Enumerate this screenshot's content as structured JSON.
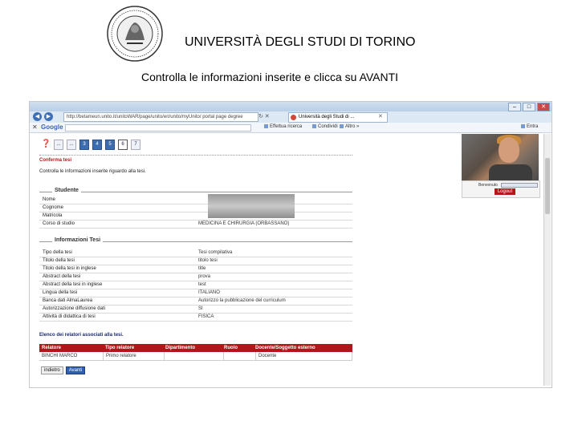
{
  "header": {
    "university": "UNIVERSITÀ DEGLI STUDI DI TORINO",
    "instruction": "Controlla le informazioni inserite e clicca su AVANTI"
  },
  "browser": {
    "address": "http://betameun.unito.it/unitoWAR/page/unito/en/unito/myUnito/ portal page degree",
    "tab_title": "Università degli Studi di ...",
    "google_label": "Google",
    "toolbar_items": [
      "Effettua ricerca",
      "Condividi",
      "Altro »"
    ],
    "toolbar_right": [
      "Entra"
    ]
  },
  "pager": {
    "items": [
      "...",
      "3",
      "4",
      "5",
      "6",
      "7"
    ],
    "current": "6"
  },
  "page": {
    "title": "Conferma tesi",
    "subtitle": "Controlla le informazioni inserite riguardo alla tesi."
  },
  "studente": {
    "legend": "Studente",
    "rows": [
      {
        "label": "Nome",
        "value": ""
      },
      {
        "label": "Cognome",
        "value": ""
      },
      {
        "label": "Matricola",
        "value": ""
      },
      {
        "label": "Corso di studio",
        "value": "MEDICINA E CHIRURGIA (ORBASSANO)"
      }
    ]
  },
  "tesi": {
    "legend": "Informazioni Tesi",
    "rows": [
      {
        "label": "Tipo della tesi",
        "value": "Tesi compilativa"
      },
      {
        "label": "Titolo della tesi",
        "value": "titolo tesi"
      },
      {
        "label": "Titolo della tesi in inglese",
        "value": "title"
      },
      {
        "label": "Abstract della tesi",
        "value": "prova"
      },
      {
        "label": "Abstract della tesi in inglese",
        "value": "test"
      },
      {
        "label": "Lingua della tesi",
        "value": "ITALIANO"
      },
      {
        "label": "Banca dati AlmaLaurea",
        "value": "Autorizzo la pubblicazione del curriculum"
      },
      {
        "label": "Autorizzazione diffusione dati",
        "value": "SI"
      },
      {
        "label": "Attività di didattica di tesi",
        "value": "FISICA"
      }
    ]
  },
  "relatori": {
    "title": "Elenco dei relatori associati alla tesi.",
    "headers": [
      "Relatore",
      "Tipo relatore",
      "Dipartimento",
      "Ruolo",
      "Docente/Soggetto esterno"
    ],
    "rows": [
      [
        "BINCHI MARCO",
        "Primo relatore",
        "",
        "",
        "Docente"
      ]
    ]
  },
  "buttons": {
    "back": "indietro",
    "next": "Avanti"
  },
  "login": {
    "label": "Benvenuto",
    "logout": "Logout"
  }
}
